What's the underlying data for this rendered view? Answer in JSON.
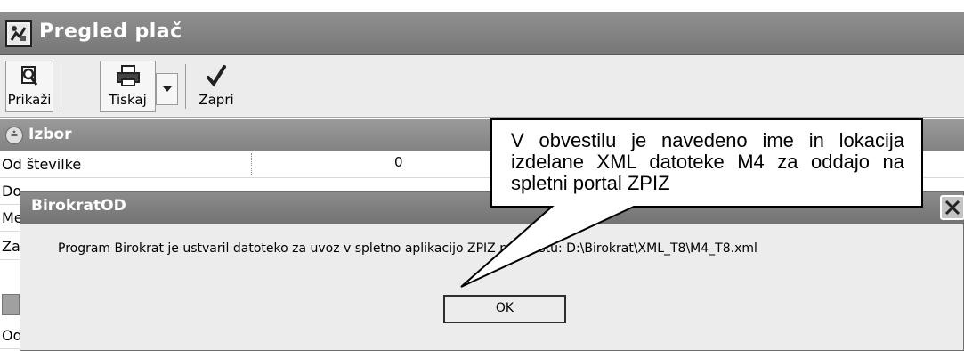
{
  "window": {
    "title": "Pregled plač",
    "icon": "app-tool-icon"
  },
  "toolbar": {
    "show_label": "Prikaži",
    "print_label": "Tiskaj",
    "close_label": "Zapri"
  },
  "section": {
    "title": "Izbor"
  },
  "form": {
    "rows": [
      {
        "label": "Od številke",
        "value": "0"
      },
      {
        "label": "Do"
      },
      {
        "label": "Me"
      },
      {
        "label": "Za"
      },
      {
        "label": ""
      },
      {
        "label": "Od"
      }
    ]
  },
  "dialog": {
    "title": "BirokratOD",
    "message": "Program Birokrat je ustvaril datoteko za uvoz v spletno aplikacijo ZPIZ na mestu:  D:\\Birokrat\\XML_T8\\M4_T8.xml",
    "ok_label": "OK"
  },
  "callout": {
    "text": "V obvestilu je navedeno ime in lokacija izdelane XML datoteke M4 za oddajo na spletni portal ZPIZ"
  }
}
